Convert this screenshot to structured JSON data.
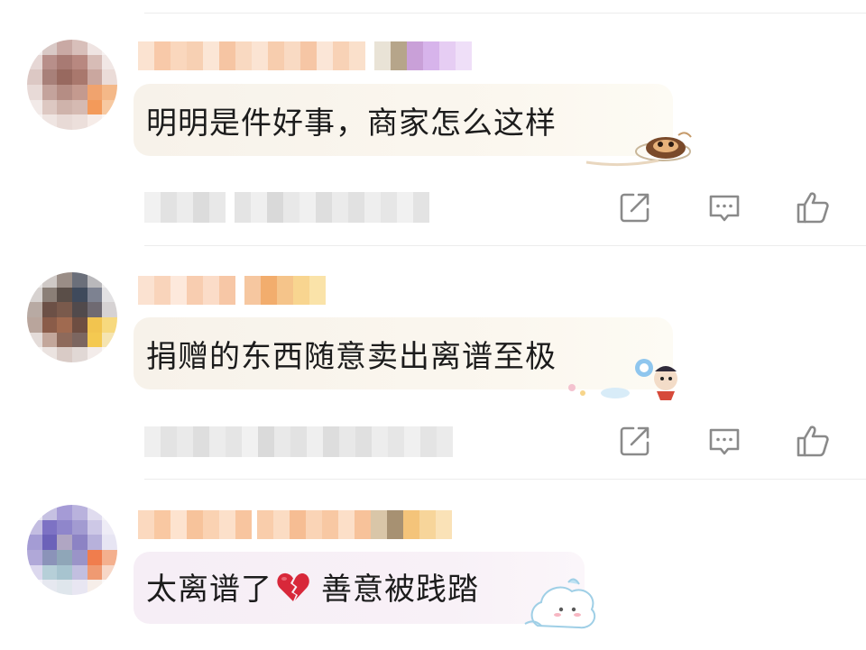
{
  "comments": [
    {
      "text": "明明是件好事，商家怎么这样",
      "bubble_style": "cream",
      "actions": [
        "share-icon",
        "reply-icon",
        "like-icon"
      ]
    },
    {
      "text": "捐赠的东西随意卖出离谱至极",
      "bubble_style": "cream",
      "actions": [
        "share-icon",
        "reply-icon",
        "like-icon"
      ]
    },
    {
      "text_before": "太离谱了",
      "emoji": "broken-heart",
      "text_after": "善意被践踏",
      "bubble_style": "pink"
    }
  ],
  "colors": {
    "icon_gray": "#8a8a8a",
    "divider": "#ececec",
    "broken_heart": "#d8283a"
  }
}
